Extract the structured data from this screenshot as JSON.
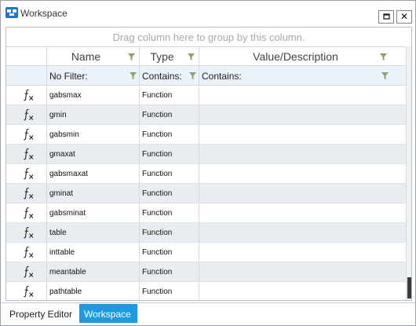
{
  "window": {
    "title": "Workspace"
  },
  "grid": {
    "group_panel_text": "Drag column here to group by this column.",
    "columns": [
      {
        "id": "icon",
        "label": ""
      },
      {
        "id": "name",
        "label": "Name"
      },
      {
        "id": "type",
        "label": "Type"
      },
      {
        "id": "value",
        "label": "Value/Description"
      }
    ],
    "filters": {
      "name": "No Filter:",
      "type": "Contains:",
      "value": "Contains:"
    },
    "rows": [
      {
        "icon": "function-icon",
        "name": "gabsmax",
        "type": "Function",
        "value": ""
      },
      {
        "icon": "function-icon",
        "name": "gmin",
        "type": "Function",
        "value": ""
      },
      {
        "icon": "function-icon",
        "name": "gabsmin",
        "type": "Function",
        "value": ""
      },
      {
        "icon": "function-icon",
        "name": "gmaxat",
        "type": "Function",
        "value": ""
      },
      {
        "icon": "function-icon",
        "name": "gabsmaxat",
        "type": "Function",
        "value": ""
      },
      {
        "icon": "function-icon",
        "name": "gminat",
        "type": "Function",
        "value": ""
      },
      {
        "icon": "function-icon",
        "name": "gabsminat",
        "type": "Function",
        "value": ""
      },
      {
        "icon": "function-icon",
        "name": "table",
        "type": "Function",
        "value": ""
      },
      {
        "icon": "function-icon",
        "name": "inttable",
        "type": "Function",
        "value": ""
      },
      {
        "icon": "function-icon",
        "name": "meantable",
        "type": "Function",
        "value": ""
      },
      {
        "icon": "function-icon",
        "name": "pathtable",
        "type": "Function",
        "value": ""
      }
    ]
  },
  "tabs": [
    {
      "label": "Property Editor",
      "active": false
    },
    {
      "label": "Workspace",
      "active": true
    }
  ],
  "colors": {
    "accent": "#1e9be0",
    "alt_row": "#e9edf1",
    "filter_row": "#ebf2fa",
    "funnel": "#8fa06a"
  },
  "icons": {
    "app": "app-icon",
    "filter": "funnel-icon",
    "row": "function-icon",
    "restore": "restore-icon",
    "close": "close-icon"
  }
}
